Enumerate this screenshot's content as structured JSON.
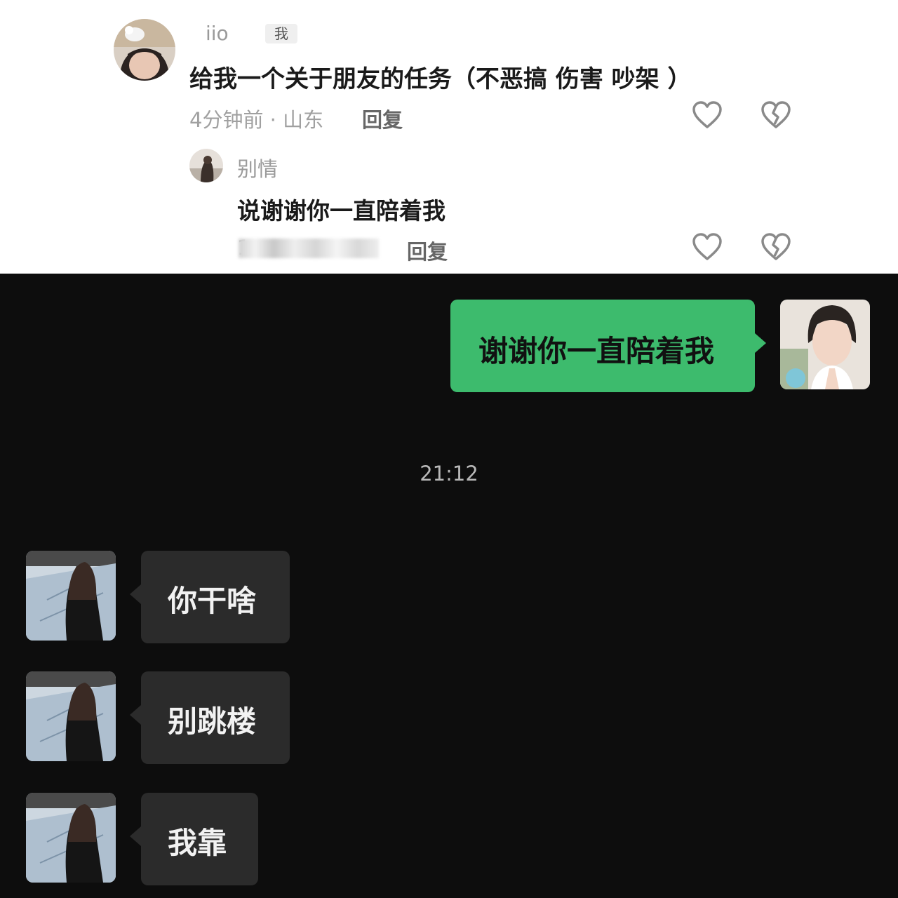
{
  "comment": {
    "username": "iio",
    "badge": "我",
    "text": "给我一个关于朋友的任务（不恶搞 伤害 吵架 ）",
    "time_location": "4分钟前 · 山东",
    "reply_label": "回复"
  },
  "reply_comment": {
    "username": "别情",
    "text": "说谢谢你一直陪着我",
    "time_prefix": "1",
    "reply_label": "回复"
  },
  "chat": {
    "outgoing": "谢谢你一直陪着我",
    "timestamp": "21:12",
    "incoming": [
      "你干啥",
      "别跳楼",
      "我靠"
    ]
  },
  "colors": {
    "green_bubble": "#3dbb6d",
    "gray_bubble": "#2b2b2b",
    "chat_background": "#0d0d0d"
  },
  "icons": [
    "heart-outline-icon",
    "broken-heart-icon"
  ]
}
